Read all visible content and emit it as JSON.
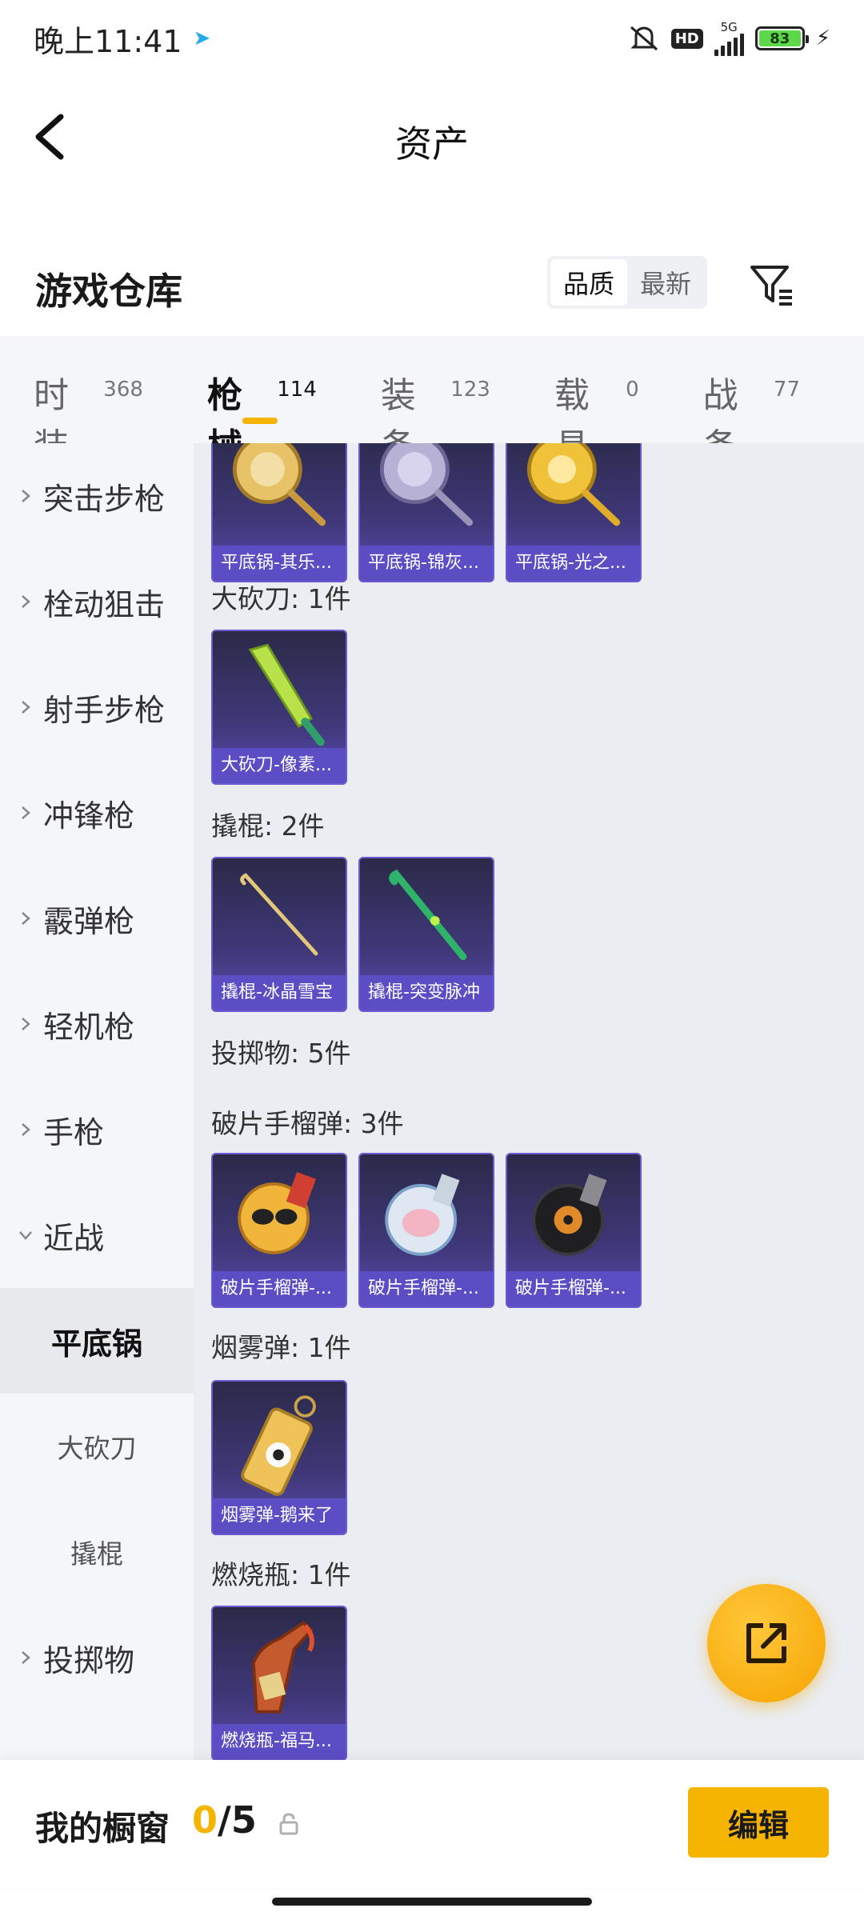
{
  "status_bar": {
    "time": "晚上11:41",
    "hd": "HD",
    "network": "5G",
    "battery": "83"
  },
  "header": {
    "title": "资产"
  },
  "warehouse": {
    "title": "游戏仓库",
    "sort_options": [
      "品质",
      "最新"
    ],
    "sort_selected": "品质"
  },
  "tabs": [
    {
      "label": "时装",
      "count": "368"
    },
    {
      "label": "枪械",
      "count": "114"
    },
    {
      "label": "装备",
      "count": "123"
    },
    {
      "label": "载具",
      "count": "0"
    },
    {
      "label": "战备",
      "count": "77"
    }
  ],
  "sidebar": {
    "categories": [
      "突击步枪",
      "栓动狙击",
      "射手步枪",
      "冲锋枪",
      "霰弹枪",
      "轻机枪",
      "手枪"
    ],
    "expanded": "近战",
    "subcategories": [
      "平底锅",
      "大砍刀",
      "撬棍"
    ],
    "after": "投掷物"
  },
  "main": {
    "pan_items": [
      "平底锅-其乐...",
      "平底锅-锦灰...",
      "平底锅-光之..."
    ],
    "machete_title": "大砍刀: 1件",
    "machete_items": [
      "大砍刀-像素..."
    ],
    "crowbar_title": "撬棍: 2件",
    "crowbar_items": [
      "撬棍-冰晶雪宝",
      "撬棍-突变脉冲"
    ],
    "throwables_title": "投掷物: 5件",
    "frag_title": "破片手榴弹: 3件",
    "frag_items": [
      "破片手榴弹-...",
      "破片手榴弹-...",
      "破片手榴弹-..."
    ],
    "smoke_title": "烟雾弹: 1件",
    "smoke_items": [
      "烟雾弹-鹅来了"
    ],
    "molotov_title": "燃烧瓶: 1件",
    "molotov_items": [
      "燃烧瓶-福马..."
    ]
  },
  "bottom": {
    "showcase_label": "我的橱窗",
    "current": "0",
    "separator": "/",
    "total": "5",
    "edit_label": "编辑"
  },
  "colors": {
    "accent": "#f5b400",
    "card_label": "#5b4ec4"
  }
}
